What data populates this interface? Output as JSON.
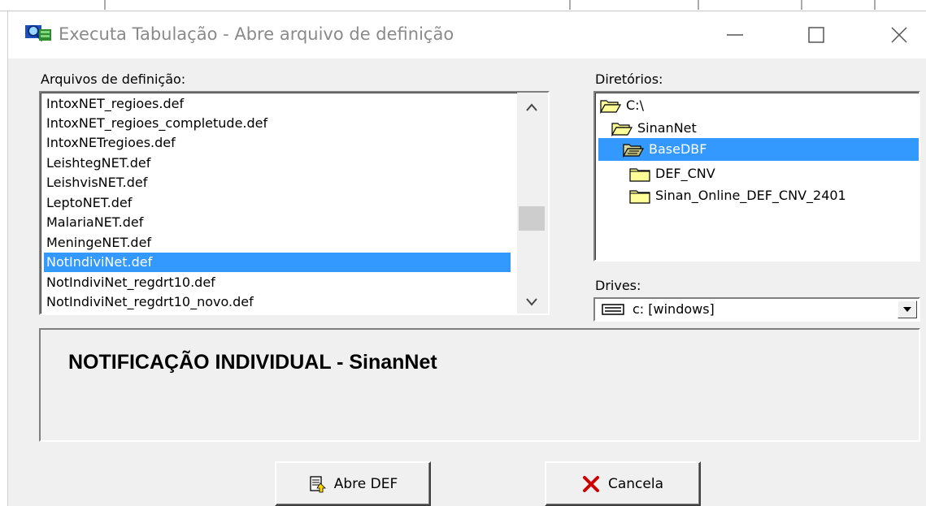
{
  "window": {
    "title": "Executa Tabulação - Abre arquivo de definição",
    "app_icon": "tabwin-icon",
    "controls": [
      "minimize-icon",
      "maximize-icon",
      "close-icon"
    ]
  },
  "files": {
    "label": "Arquivos de definição:",
    "items": [
      "IntoxNET_regioes.def",
      "IntoxNET_regioes_completude.def",
      "IntoxNETregioes.def",
      "LeishtegNET.def",
      "LeishvisNET.def",
      "LeptoNET.def",
      "MalariaNET.def",
      "MeningeNET.def",
      "NotIndiviNet.def",
      "NotIndiviNet_regdrt10.def",
      "NotIndiviNet_regdrt10_novo.def"
    ],
    "selected": "NotIndiviNet.def"
  },
  "directories": {
    "label": "Diretórios:",
    "items": [
      "C:\\",
      "SinanNet",
      "BaseDBF",
      "DEF_CNV",
      "Sinan_Online_DEF_CNV_2401"
    ],
    "selected": "BaseDBF"
  },
  "drives": {
    "label": "Drives:",
    "value": "c: [windows]"
  },
  "description": "NOTIFICAÇÃO INDIVIDUAL - SinanNet",
  "buttons": {
    "open_label": "Abre DEF",
    "cancel_label": "Cancela"
  },
  "colors": {
    "selection": "#3399ff",
    "folder": "#ffff99",
    "cancel_x": "#cc0000"
  }
}
